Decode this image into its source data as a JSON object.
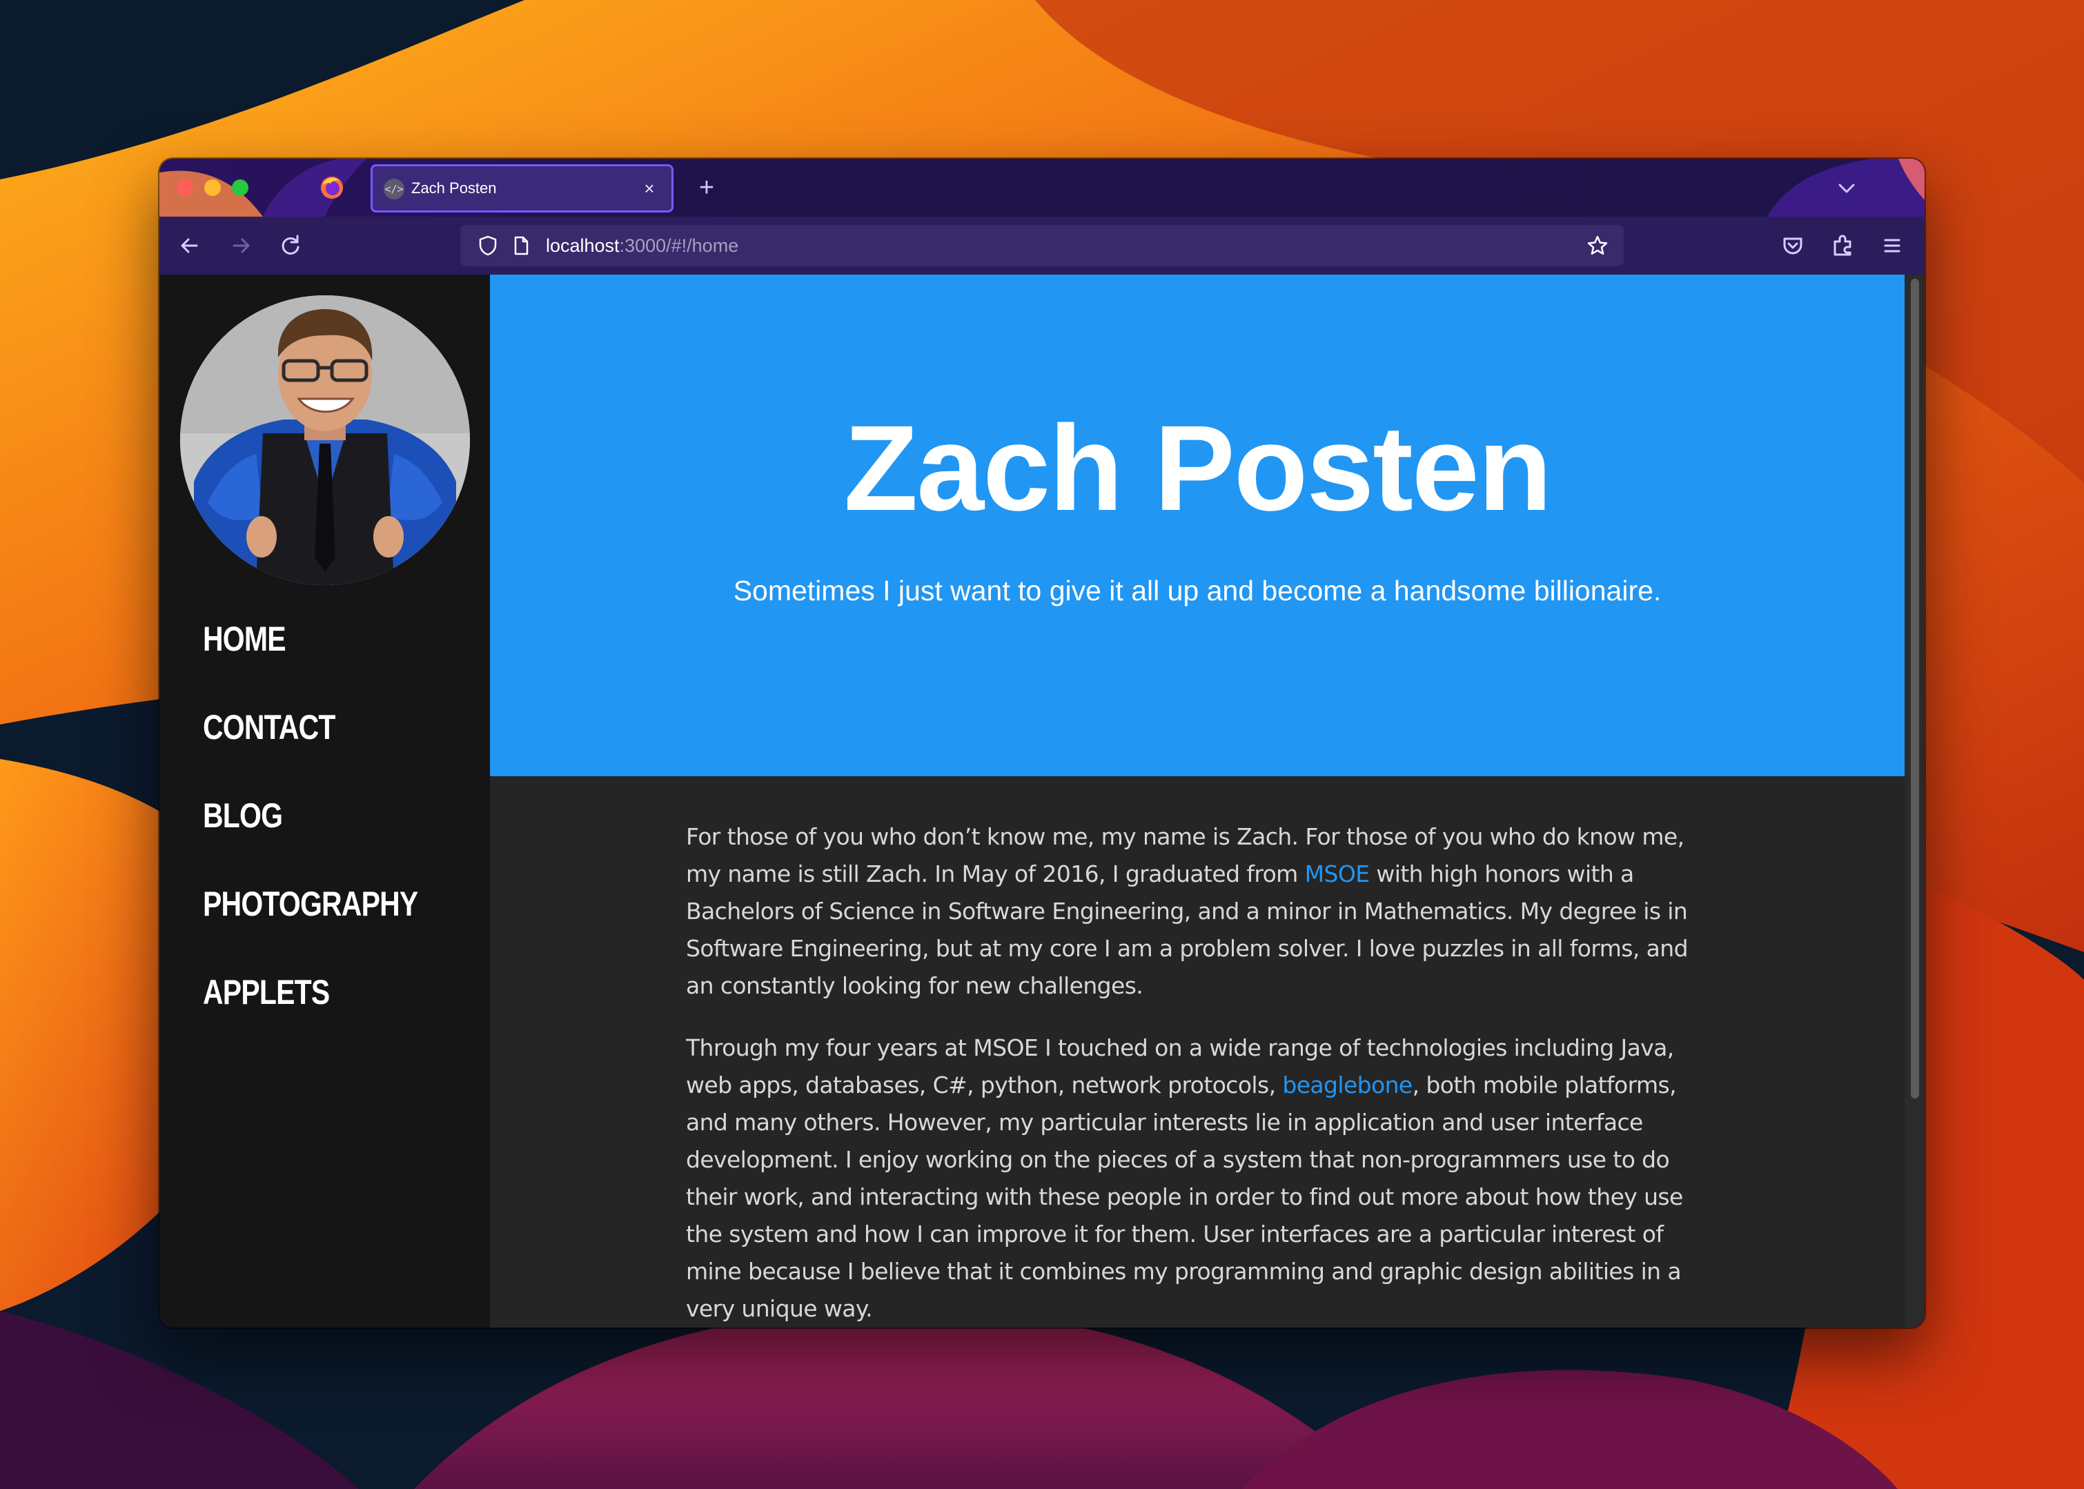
{
  "browser": {
    "tab": {
      "title": "Zach Posten",
      "favicon": "code-icon",
      "close": "×"
    },
    "new_tab_label": "+",
    "url": {
      "host": "localhost",
      "path": ":3000/#!/home"
    },
    "toolbar_icons": [
      "back-arrow-icon",
      "forward-arrow-icon",
      "reload-icon",
      "shield-icon",
      "page-icon",
      "bookmark-star-icon",
      "pocket-icon",
      "extensions-icon",
      "hamburger-menu-icon"
    ]
  },
  "sidebar": {
    "nav": [
      {
        "label": "HOME"
      },
      {
        "label": "CONTACT"
      },
      {
        "label": "BLOG"
      },
      {
        "label": "PHOTOGRAPHY"
      },
      {
        "label": "APPLETS"
      }
    ]
  },
  "hero": {
    "title": "Zach Posten",
    "tagline": "Sometimes I just want to give it all up and become a handsome billionaire."
  },
  "content": {
    "p1_before": "For those of you who don’t know me, my name is Zach. For those of you who do know me, my name is still Zach. In May of 2016, I graduated from ",
    "p1_link": "MSOE",
    "p1_after": " with high honors with a Bachelors of Science in Software Engineering, and a minor in Mathematics. My degree is in Software Engineering, but at my core I am a problem solver. I love puzzles in all forms, and an constantly looking for new challenges.",
    "p2_before": "Through my four years at MSOE I touched on a wide range of technologies including Java, web apps, databases, C#, python, network protocols, ",
    "p2_link": "beaglebone",
    "p2_after": ", both mobile platforms, and many others. However, my particular interests lie in application and user interface development. I enjoy working on the pieces of a system that non-programmers use to do their work, and interacting with these people in order to find out more about how they use the system and how I can improve it for them. User interfaces are a particular interest of mine because I believe that it combines my programming and graphic design abilities in a very unique way."
  },
  "colors": {
    "accent": "#2196f3",
    "sidebar_bg": "#151515",
    "content_bg": "#252525",
    "browser_chrome": "#2b1d5c"
  }
}
